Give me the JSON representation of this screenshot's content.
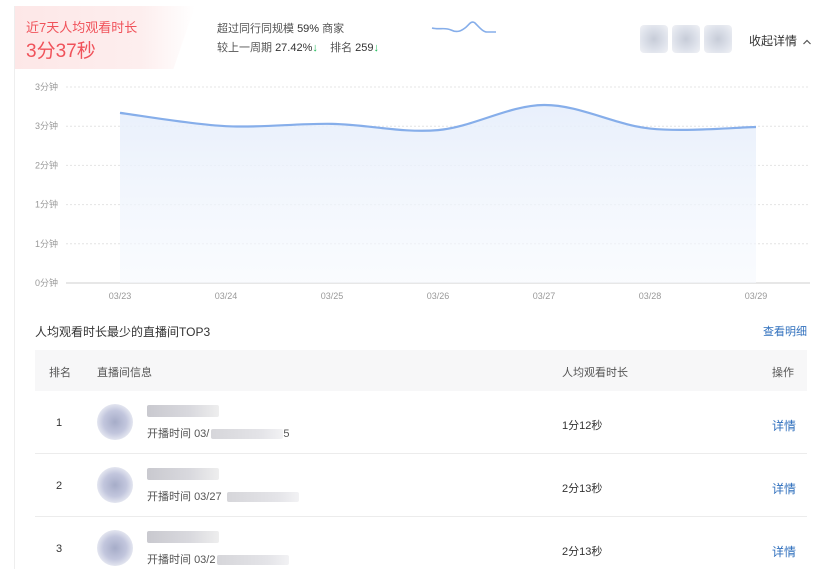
{
  "header": {
    "metric_title": "近7天人均观看时长",
    "metric_value": "3分37秒",
    "exceed_text": "超过同行同规模",
    "exceed_value": "59%",
    "exceed_suffix": "商家",
    "wow_label": "较上一周期",
    "wow_value": "27.42%",
    "rank_label": "排名",
    "rank_value": "259",
    "collapse_label": "收起详情",
    "down_arrow": "↓",
    "chevron_up": "^"
  },
  "colors": {
    "accent_red": "#f0525a",
    "line_blue": "#86aeea",
    "link_blue": "#2f6fbd",
    "down_green": "#19b955"
  },
  "chart_data": {
    "type": "area",
    "categories": [
      "03/23",
      "03/24",
      "03/25",
      "03/26",
      "03/27",
      "03/28",
      "03/29"
    ],
    "y_tick_labels": [
      "0分钟",
      "1分钟",
      "1分钟",
      "2分钟",
      "3分钟",
      "3分钟"
    ],
    "ylim": [
      0,
      250
    ],
    "series": [
      {
        "values": [
          217,
          200,
          203,
          195,
          227,
          197,
          199
        ]
      }
    ],
    "grid": true,
    "title": "",
    "xlabel": "",
    "ylabel": ""
  },
  "table": {
    "title": "人均观看时长最少的直播间TOP3",
    "view_all": "查看明细",
    "headers": {
      "rank": "排名",
      "info": "直播间信息",
      "duration": "人均观看时长",
      "action": "操作"
    },
    "rows": [
      {
        "rank": "1",
        "start_label": "开播时间",
        "start_visible": "03/",
        "start_tail": "5",
        "duration": "1分12秒",
        "action": "详情"
      },
      {
        "rank": "2",
        "start_label": "开播时间",
        "start_visible": "03/27 ",
        "start_tail": "",
        "duration": "2分13秒",
        "action": "详情"
      },
      {
        "rank": "3",
        "start_label": "开播时间",
        "start_visible": "03/2",
        "start_tail": "",
        "duration": "2分13秒",
        "action": "详情"
      }
    ]
  }
}
